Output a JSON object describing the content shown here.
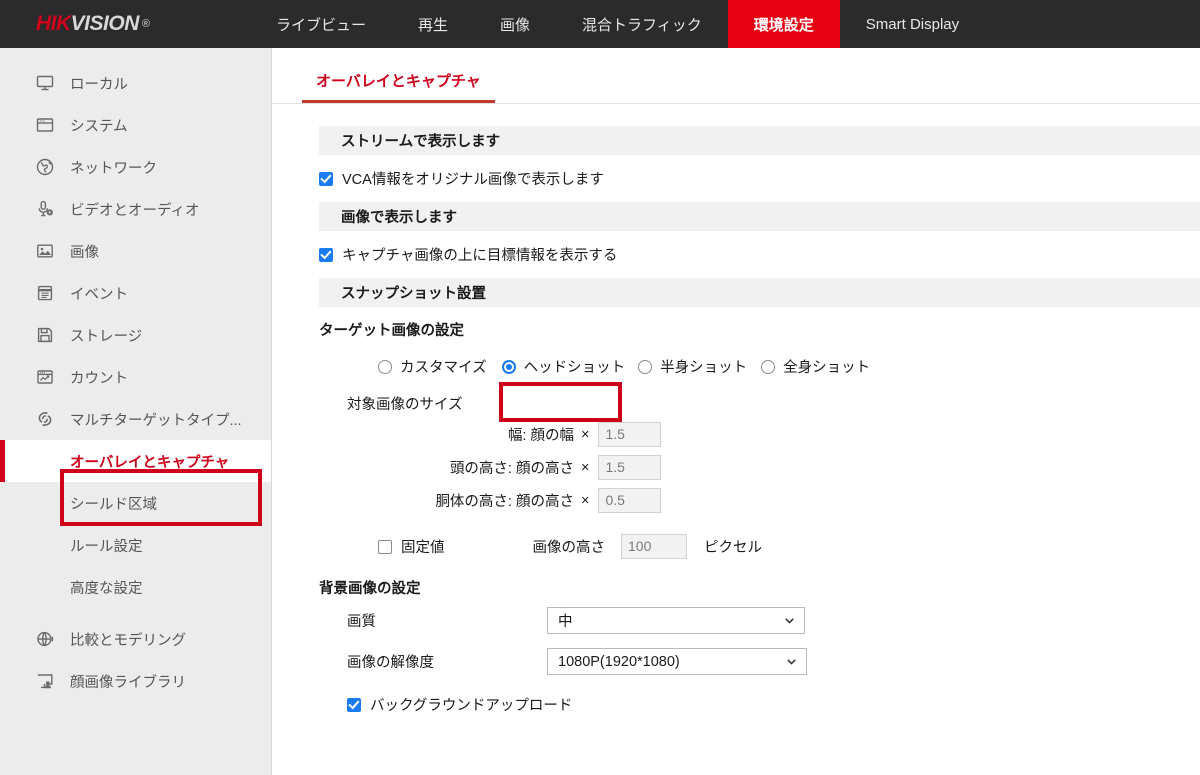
{
  "brand": {
    "hik": "HIK",
    "vision": "VISION",
    "registered": "®"
  },
  "topnav": {
    "items": [
      {
        "label": "ライブビュー",
        "active": false
      },
      {
        "label": "再生",
        "active": false
      },
      {
        "label": "画像",
        "active": false
      },
      {
        "label": "混合トラフィック",
        "active": false
      },
      {
        "label": "環境設定",
        "active": true
      },
      {
        "label": "Smart Display",
        "active": false
      }
    ],
    "active_color": "#e60012"
  },
  "sidebar": {
    "items": [
      {
        "label": "ローカル",
        "icon": "monitor-icon",
        "sub": false,
        "selected": false
      },
      {
        "label": "システム",
        "icon": "window-icon",
        "sub": false,
        "selected": false
      },
      {
        "label": "ネットワーク",
        "icon": "globe-icon",
        "sub": false,
        "selected": false
      },
      {
        "label": "ビデオとオーディオ",
        "icon": "microphone-icon",
        "sub": false,
        "selected": false
      },
      {
        "label": "画像",
        "icon": "picture-icon",
        "sub": false,
        "selected": false
      },
      {
        "label": "イベント",
        "icon": "calendar-icon",
        "sub": false,
        "selected": false
      },
      {
        "label": "ストレージ",
        "icon": "save-disk-icon",
        "sub": false,
        "selected": false
      },
      {
        "label": "カウント",
        "icon": "chart-window-icon",
        "sub": false,
        "selected": false
      },
      {
        "label": "マルチターゲットタイプ...",
        "icon": "multi-target-icon",
        "sub": false,
        "selected": false
      },
      {
        "label": "オーバレイとキャプチャ",
        "icon": "",
        "sub": true,
        "selected": true
      },
      {
        "label": "シールド区域",
        "icon": "",
        "sub": true,
        "selected": false
      },
      {
        "label": "ルール設定",
        "icon": "",
        "sub": true,
        "selected": false
      },
      {
        "label": "高度な設定",
        "icon": "",
        "sub": true,
        "selected": false
      },
      {
        "label": "比較とモデリング",
        "icon": "compare-icon",
        "sub": false,
        "selected": false
      },
      {
        "label": "顔画像ライブラリ",
        "icon": "face-library-icon",
        "sub": false,
        "selected": false
      }
    ],
    "selected_color": "#d0021b"
  },
  "tab": {
    "label": "オーバレイとキャプチャ"
  },
  "sections": {
    "stream_display": {
      "title": "ストリームで表示します",
      "checkbox_label": "VCA情報をオリジナル画像で表示します",
      "checked": true
    },
    "image_display": {
      "title": "画像で表示します",
      "checkbox_label": "キャプチャ画像の上に目標情報を表示する",
      "checked": true
    },
    "snapshot": {
      "title": "スナップショット設置",
      "target_image_heading": "ターゲット画像の設定",
      "radios": [
        {
          "label": "カスタマイズ",
          "selected": false
        },
        {
          "label": "ヘッドショット",
          "selected": true
        },
        {
          "label": "半身ショット",
          "selected": false
        },
        {
          "label": "全身ショット",
          "selected": false
        }
      ],
      "size_heading": "対象画像のサイズ",
      "size_rows": [
        {
          "label": "幅:  顔の幅",
          "mult": "×",
          "value": "1.5"
        },
        {
          "label": "頭の高さ:  顔の高さ",
          "mult": "×",
          "value": "1.5"
        },
        {
          "label": "胴体の高さ:  顔の高さ",
          "mult": "×",
          "value": "0.5"
        }
      ],
      "fixed": {
        "checkbox_label": "固定値",
        "checked": false,
        "height_label": "画像の高さ",
        "height_value": "100",
        "unit": "ピクセル"
      }
    },
    "background": {
      "title": "背景画像の設定",
      "quality": {
        "label": "画質",
        "value": "中"
      },
      "resolution": {
        "label": "画像の解像度",
        "value": "1080P(1920*1080)"
      },
      "upload": {
        "label": "バックグラウンドアップロード",
        "checked": true
      }
    }
  }
}
